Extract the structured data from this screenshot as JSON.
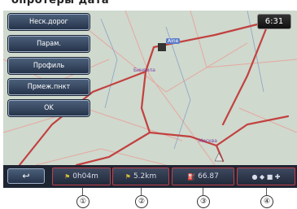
{
  "header_fragment": "опротеры дата",
  "menu": {
    "items": [
      {
        "label": "Неск.дорог"
      },
      {
        "label": "Парам."
      },
      {
        "label": "Профиль"
      },
      {
        "label": "Прмеж.пнкт"
      },
      {
        "label": "OK"
      }
    ]
  },
  "clock": {
    "time": "6:31"
  },
  "map": {
    "labels": {
      "start": "Aine",
      "city1": "Бинвила",
      "city2": "Москва"
    }
  },
  "bottom_bar": {
    "back_icon": "return-arrow-icon",
    "info": [
      {
        "icon": "flag-icon",
        "value": "0h04m"
      },
      {
        "icon": "flag-icon",
        "value": "5.2km"
      },
      {
        "icon": "fuel-icon",
        "value": "66.87"
      },
      {
        "icon": "poi-icons",
        "value": ""
      }
    ]
  },
  "callouts": [
    "①",
    "②",
    "③",
    "④"
  ]
}
